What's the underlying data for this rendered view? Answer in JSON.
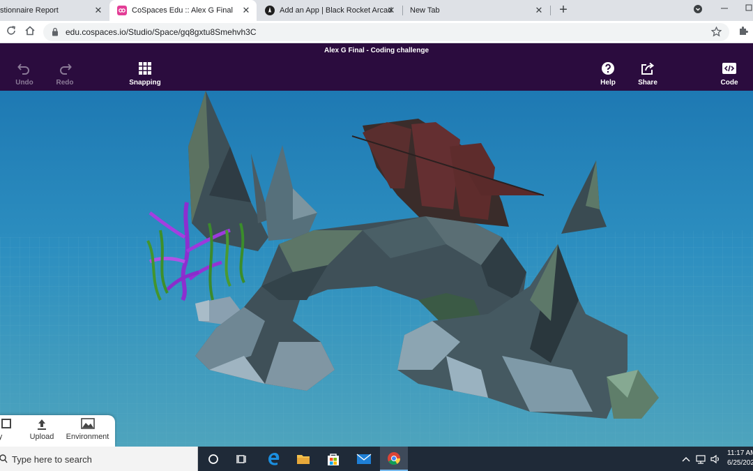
{
  "browser": {
    "tabs": [
      {
        "label": "stionnaire Report",
        "active": false
      },
      {
        "label": "CoSpaces Edu :: Alex G Final",
        "active": true
      },
      {
        "label": "Add an App | Black Rocket Arcad",
        "active": false
      },
      {
        "label": "New Tab",
        "active": false
      }
    ],
    "new_tab_glyph": "+",
    "close_glyph": "✕",
    "address": "edu.cospaces.io/Studio/Space/gq8gxtu8Smehvh3C"
  },
  "app": {
    "title": "Alex G Final - Coding challenge",
    "toolbar": {
      "undo_label": "Undo",
      "redo_label": "Redo",
      "snapping_label": "Snapping",
      "help_label": "Help",
      "share_label": "Share",
      "code_label": "Code"
    },
    "bottom_panel": {
      "library_label": "ary",
      "upload_label": "Upload",
      "environment_label": "Environment"
    }
  },
  "taskbar": {
    "search_placeholder": "Type here to search",
    "time": "11:17 AM",
    "date": "6/25/202"
  },
  "colors": {
    "header_bg": "#2b0c3e",
    "water_top": "#1e79b3",
    "water_bottom": "#4fa3bd",
    "taskbar_bg": "#1f2a38"
  }
}
